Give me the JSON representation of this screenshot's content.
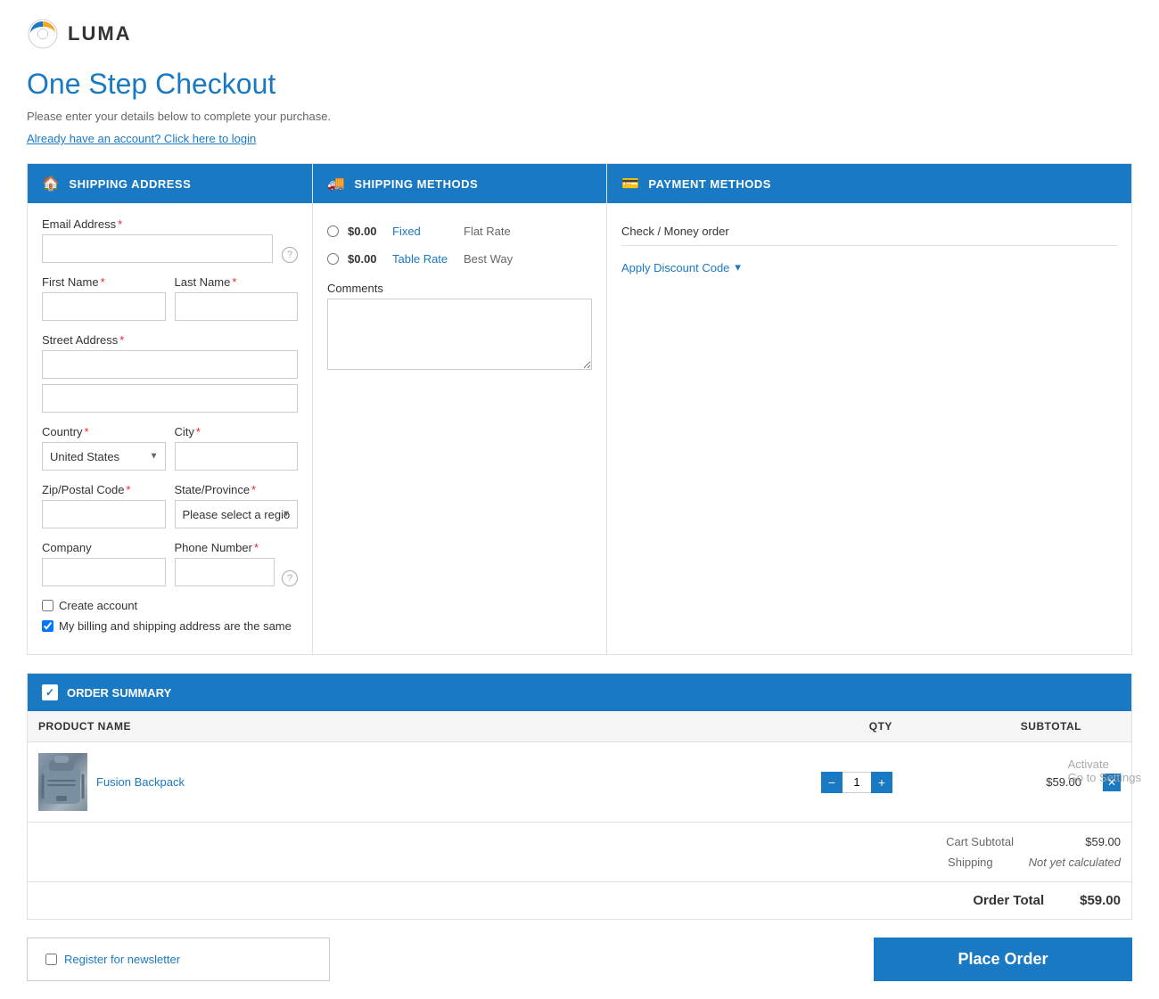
{
  "logo": {
    "text": "LUMA"
  },
  "page": {
    "title_plain": "One Step ",
    "title_highlight": "Checkout",
    "subtitle": "Please enter your details below to complete your purchase.",
    "login_text": "Already have an account? Click here to login"
  },
  "shipping_address": {
    "header": "SHIPPING ADDRESS",
    "email_label": "Email Address",
    "first_name_label": "First Name",
    "last_name_label": "Last Name",
    "street_label": "Street Address",
    "country_label": "Country",
    "city_label": "City",
    "zip_label": "Zip/Postal Code",
    "state_label": "State/Province",
    "company_label": "Company",
    "phone_label": "Phone Number",
    "country_value": "United States",
    "state_placeholder": "Please select a region",
    "create_account_label": "Create account",
    "billing_same_label": "My billing and shipping address are the same"
  },
  "shipping_methods": {
    "header": "SHIPPING METHODS",
    "options": [
      {
        "price": "$0.00",
        "method": "Fixed",
        "carrier": "Flat Rate"
      },
      {
        "price": "$0.00",
        "method": "Table Rate",
        "carrier": "Best Way"
      }
    ],
    "comments_label": "Comments"
  },
  "payment_methods": {
    "header": "PAYMENT METHODS",
    "option": "Check / Money order",
    "discount_label": "Apply Discount Code",
    "discount_icon": "▾"
  },
  "order_summary": {
    "header": "ORDER SUMMARY",
    "columns": {
      "product": "PRODUCT NAME",
      "qty": "QTY",
      "subtotal": "SUBTOTAL"
    },
    "items": [
      {
        "name": "Fusion Backpack",
        "qty": 1,
        "price": "$59.00"
      }
    ],
    "cart_subtotal_label": "Cart Subtotal",
    "cart_subtotal_value": "$59.00",
    "shipping_label": "Shipping",
    "shipping_value": "Not yet calculated",
    "order_total_label": "Order Total",
    "order_total_value": "$59.00"
  },
  "bottom": {
    "newsletter_label": "Register for newsletter",
    "place_order_label": "Place Order"
  },
  "watermark": {
    "line1": "Activate",
    "line2": "Go to Settings"
  }
}
